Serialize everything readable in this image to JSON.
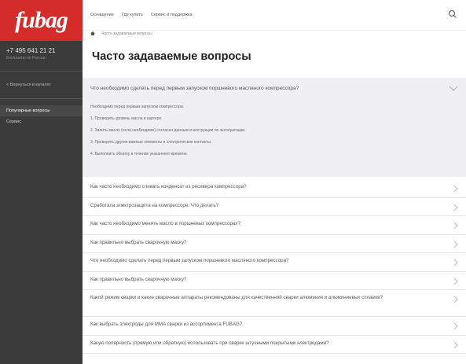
{
  "sidebar": {
    "logo": "fubag",
    "phone": "+7 495 641 21 21",
    "phone_sub": "Бесплатно по России",
    "back_link": "< Вернуться в каталог",
    "items": [
      {
        "label": "Популярные вопросы"
      },
      {
        "label": "Сервис"
      }
    ]
  },
  "topbar": {
    "links": [
      "Оснащение",
      "Где купить",
      "Сервис и поддержка"
    ]
  },
  "breadcrumb": "Часто задаваемые вопросы",
  "page_title": "Часто задаваемые вопросы",
  "open_faq": {
    "question": "Что необходимо сделать перед первым запуском поршневого масляного компрессора?",
    "answer_intro": "Необходимо перед первым запуском компрессора:",
    "answer_lines": [
      "1. Проверить уровень масла в картере.",
      "2. Залить масло (если необходимо) согласно данным в инструкции по эксплуатации.",
      "3. Проверить другие важные элементы и электрические контакты.",
      "4. Выполнить обкатку в течение указанного времени."
    ]
  },
  "faqs": [
    {
      "question": "Как часто необходимо сливать конденсат из ресивера компрессора?"
    },
    {
      "question": "Сработала электрозащита на компрессоре. Что делать?"
    },
    {
      "question": "Как часто необходимо менять масло в поршневых компрессорах?"
    },
    {
      "question": "Как правильно выбрать сварочную маску?"
    },
    {
      "question": "Что необходимо сделать перед первым запуском поршневого масляного компрессора?"
    },
    {
      "question": "Как правильно выбрать сварочную маску?"
    },
    {
      "question": "Какой режим сварки и какие сварочные аппараты рекомендованы для качественной сварки алюминия и алюминиевых сплавов?"
    },
    {
      "question": "Как выбрать электроды для MMA сварки из ассортимента FUBAG?"
    },
    {
      "question": "Какую полярность (прямую или обратную) использовать при сварке штучными покрытыми электродами?"
    }
  ]
}
